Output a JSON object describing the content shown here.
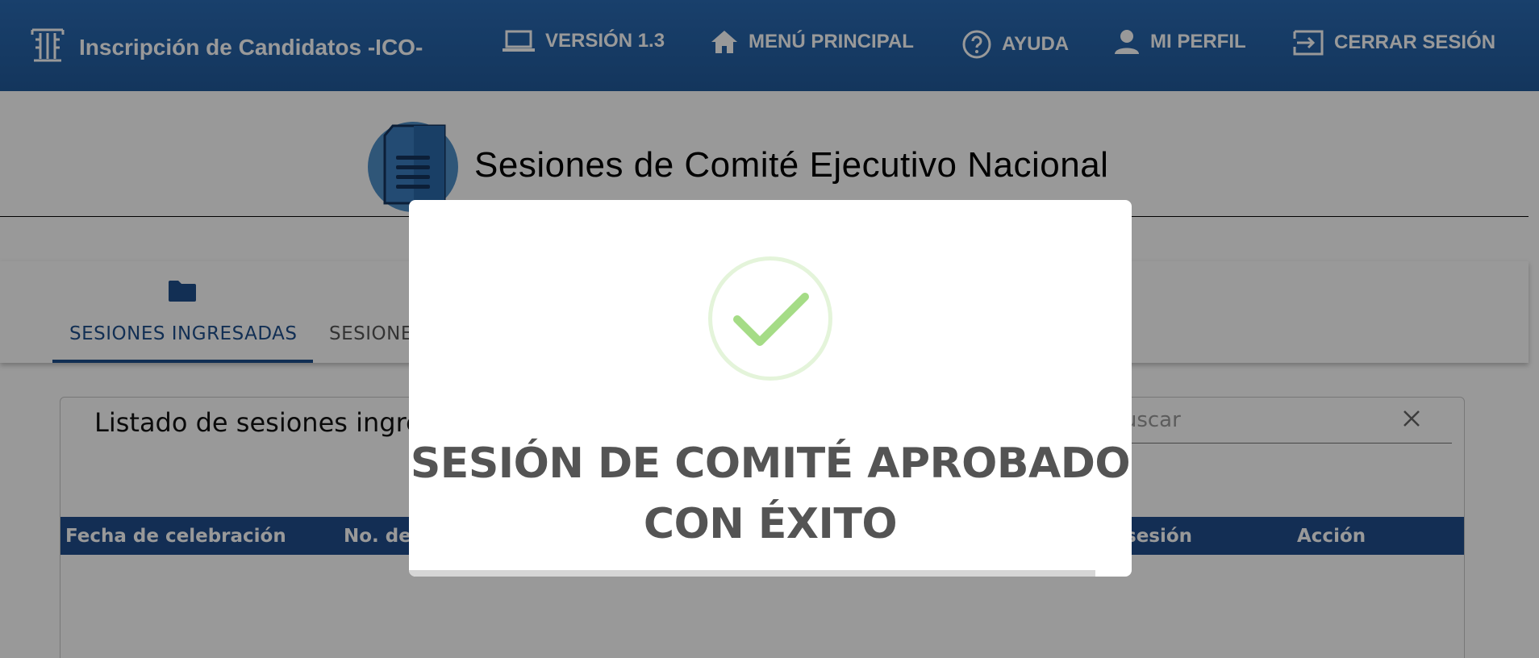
{
  "app": {
    "title": "Inscripción de Candidatos -ICO-"
  },
  "nav": {
    "version": "VERSIÓN 1.3",
    "home": "MENÚ PRINCIPAL",
    "help": "AYUDA",
    "profile": "MI PERFIL",
    "logout": "CERRAR SESIÓN"
  },
  "page": {
    "title": "Sesiones de Comité Ejecutivo Nacional"
  },
  "tabs": [
    {
      "label": "SESIONES INGRESADAS",
      "icon": "folder-icon",
      "active": true
    },
    {
      "label": "SESIONE",
      "active": false
    }
  ],
  "list": {
    "title": "Listado de sesiones ingre",
    "search_placeholder": "Buscar",
    "columns": [
      "Fecha de celebración",
      "No. de",
      "sesión",
      "Acción"
    ]
  },
  "modal": {
    "icon": "success-check-icon",
    "message_line1": "SESIÓN DE COMITÉ APROBADO",
    "message_line2": "CON ÉXITO",
    "timer_progress": 0.95
  },
  "colors": {
    "topbar": "#215a9b",
    "accent": "#1e4f8c",
    "table_header": "#214d8c",
    "success": "#a5dc86"
  }
}
